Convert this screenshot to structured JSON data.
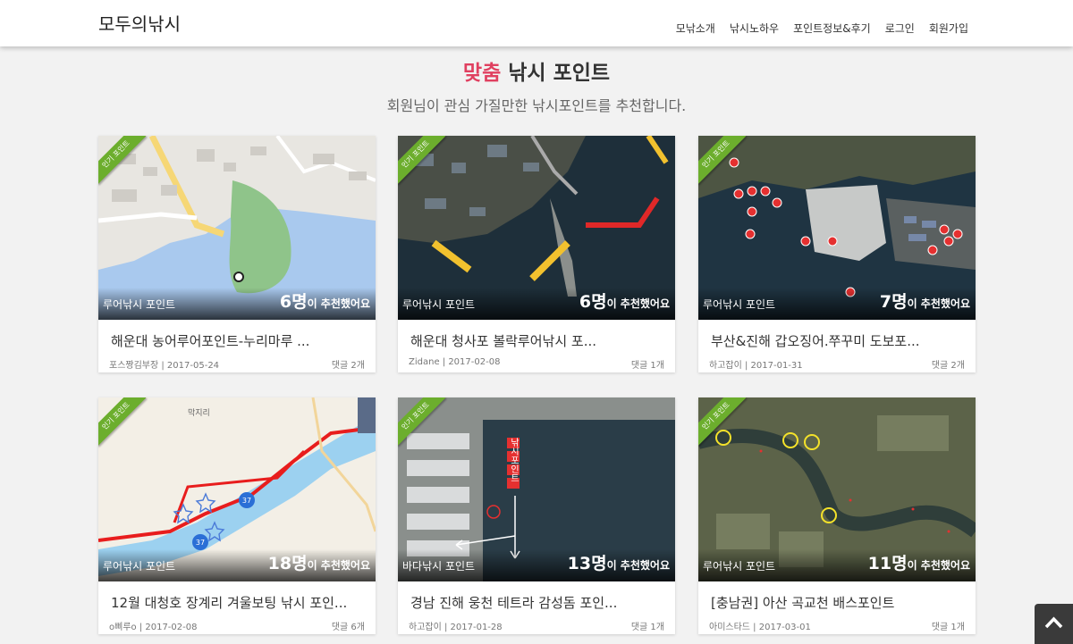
{
  "navbar": {
    "brand": "모두의낚시",
    "menu": [
      "모낚소개",
      "낚시노하우",
      "포인트정보&후기",
      "로그인",
      "회원가입"
    ]
  },
  "hero": {
    "title_accent": "맞춤",
    "title_rest": " 낚시 포인트",
    "subtitle": "회원님이 관심 가질만한 낚시포인트를 추천합니다."
  },
  "cards": [
    {
      "ribbon": "인기 포인트",
      "category": "루어낚시 포인트",
      "rec_count": "6명",
      "rec_suffix": "이 추천했어요",
      "title": "해운대 농어루어포인트-누리마루 ...",
      "meta": "포스짱김부장 | 2017-05-24",
      "comments": "댓글 2개",
      "map": "street-map"
    },
    {
      "ribbon": "인기 포인트",
      "category": "루어낚시 포인트",
      "rec_count": "6명",
      "rec_suffix": "이 추천했어요",
      "title": "해운대 청사포 볼락루어낚시 포...",
      "meta": "Zidane | 2017-02-08",
      "comments": "댓글 1개",
      "map": "harbor-satellite"
    },
    {
      "ribbon": "인기 포인트",
      "category": "루어낚시 포인트",
      "rec_count": "7명",
      "rec_suffix": "이 추천했어요",
      "title": "부산&진해 갑오징어.쭈꾸미 도보포...",
      "meta": "하고잡이 | 2017-01-31",
      "comments": "댓글 2개",
      "map": "port-satellite"
    },
    {
      "ribbon": "인기 포인트",
      "category": "루어낚시 포인트",
      "rec_count": "18명",
      "rec_suffix": "이 추천했어요",
      "title": "12월 대청호 장계리 겨울보팅 낚시 포인...",
      "meta": "o삐루o | 2017-02-08",
      "comments": "댓글 6개",
      "map": "river-route-map",
      "map_label": "막지리",
      "road_badge": "37"
    },
    {
      "ribbon": "인기 포인트",
      "category": "바다낚시 포인트",
      "rec_count": "13명",
      "rec_suffix": "이 추천했어요",
      "title": "경남 진해 웅천 테트라 감성돔 포인...",
      "meta": "하고잡이 | 2017-01-28",
      "comments": "댓글 1개",
      "map": "pier-satellite",
      "map_label": "낚시포인트"
    },
    {
      "ribbon": "인기 포인트",
      "category": "루어낚시 포인트",
      "rec_count": "11명",
      "rec_suffix": "이 추천했어요",
      "title": "[충남권] 아산 곡교천 배스포인트",
      "meta": "아미스타드 | 2017-03-01",
      "comments": "댓글 1개",
      "map": "stream-satellite"
    }
  ],
  "scroll_top_icon": "chevron-up-icon"
}
